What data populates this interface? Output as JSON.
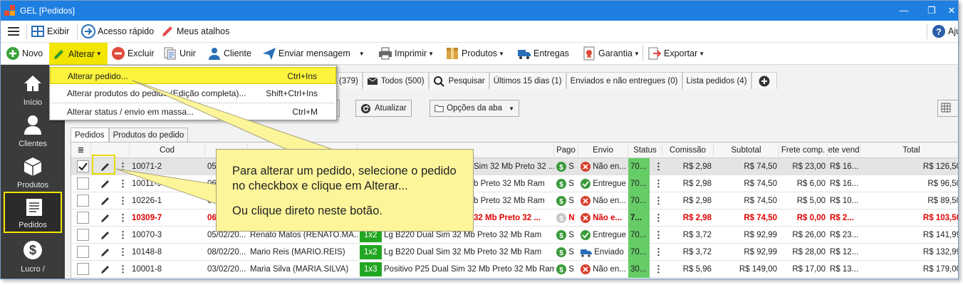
{
  "window": {
    "title": "GEL [Pedidos]",
    "colors": {
      "titlebar": "#1f7fe0",
      "sidebar": "#3b3b3b",
      "highlight": "#f2e600",
      "callout": "#fdf59a"
    }
  },
  "toolbar1": {
    "exibir": "Exibir",
    "acesso_rapido": "Acesso rápido",
    "meus_atalhos": "Meus atalhos",
    "ajuda": "Aju"
  },
  "toolbar2": {
    "novo": "Novo",
    "alterar": "Alterar",
    "excluir": "Excluir",
    "unir": "Unir",
    "cliente": "Cliente",
    "enviar_mensagem": "Enviar mensagem",
    "imprimir": "Imprimir",
    "produtos": "Produtos",
    "entregas": "Entregas",
    "garantia": "Garantia",
    "exportar": "Exportar"
  },
  "sidebar": {
    "items": [
      {
        "label": "Início"
      },
      {
        "label": "Clientes"
      },
      {
        "label": "Produtos"
      },
      {
        "label": "Pedidos"
      },
      {
        "label": "Lucro /"
      }
    ]
  },
  "menu": {
    "items": [
      {
        "label": "Alterar pedido...",
        "shortcut": "Ctrl+Ins"
      },
      {
        "label": "Alterar produtos do pedido (Edição completa)...",
        "shortcut": "Shift+Ctrl+Ins"
      },
      {
        "label": "Alterar status / envio em massa...",
        "shortcut": "Ctrl+M"
      }
    ]
  },
  "filter_tabs": {
    "count_379": "(379)",
    "todos": "Todos (500)",
    "pesquisar": "Pesquisar",
    "ultimos": "Últimos 15 dias (1)",
    "enviados": "Enviados e não entregues (0)",
    "lista": "Lista pedidos (4)",
    "add": "+"
  },
  "actions": {
    "atualizar": "Atualizar",
    "opcoes": "Opções da aba"
  },
  "inner_tabs": {
    "pedidos": "Pedidos",
    "produtos_pedido": "Produtos do pedido"
  },
  "columns": {
    "cod": "Cod",
    "pago": "Pago",
    "envio": "Envio",
    "status": "Status",
    "comissao": "Comissão",
    "subtotal": "Subtotal",
    "frete_comp": "Frete comp.",
    "frete_vend": "ete vend",
    "total": "Total"
  },
  "rows": [
    {
      "cod": "10071-2",
      "data": "05/",
      "pago_letter": "S",
      "envio": "Não en...",
      "status": "70...",
      "comissao": "R$ 2,98",
      "subtotal": "R$ 74,50",
      "frete_comp": "R$ 23,00",
      "frete_vend": "R$ 16...",
      "total": "R$ 126,50",
      "produto_tail": "Sim 32 Mb Preto 32 ..."
    },
    {
      "cod": "10011-9",
      "data": "06/",
      "pago_letter": "S",
      "envio": "Entregue",
      "status": "70...",
      "comissao": "R$ 2,98",
      "subtotal": "R$ 74,50",
      "frete_comp": "R$ 6,00",
      "frete_vend": "R$ 16...",
      "total": "R$ 96,50",
      "produto_tail": "b Preto 32 Mb Ram"
    },
    {
      "cod": "10226-1",
      "data": "06/",
      "pago_letter": "S",
      "envio": "Não en...",
      "status": "70...",
      "comissao": "R$ 2,98",
      "subtotal": "R$ 74,50",
      "frete_comp": "R$ 5,00",
      "frete_vend": "R$ 10...",
      "total": "R$ 89,50",
      "produto_tail": "b Preto 32 Mb Ram"
    },
    {
      "cod": "10309-7",
      "data": "06",
      "pago_letter": "N",
      "envio": "Não e...",
      "status": "7...",
      "comissao": "R$ 2,98",
      "subtotal": "R$ 74,50",
      "frete_comp": "R$ 0,00",
      "frete_vend": "R$ 2...",
      "total": "R$ 103,50",
      "produto_tail": "32 Mb Preto 32 ..."
    },
    {
      "cod": "10070-3",
      "data": "05/02/20...",
      "cliente": "Renato Matos (RENATO.MA...",
      "qty": "1x2",
      "produto": "Lg B220 Dual Sim 32 Mb Preto 32 Mb Ram",
      "pago_letter": "S",
      "envio": "Entregue",
      "status": "70...",
      "comissao": "R$ 3,72",
      "subtotal": "R$ 92,99",
      "frete_comp": "R$ 26,00",
      "frete_vend": "R$ 23...",
      "total": "R$ 141,99"
    },
    {
      "cod": "10148-8",
      "data": "08/02/20...",
      "cliente": "Mario Reis (MARIO.REIS)",
      "qty": "1x2",
      "produto": "Lg B220 Dual Sim 32 Mb Preto 32 Mb Ram",
      "pago_letter": "S",
      "envio": "Enviado",
      "status": "70...",
      "comissao": "R$ 3,72",
      "subtotal": "R$ 92,99",
      "frete_comp": "R$ 28,00",
      "frete_vend": "R$ 12...",
      "total": "R$ 132,99"
    },
    {
      "cod": "10001-8",
      "data": "03/02/20...",
      "cliente": "Maria Silva (MARIA.SILVA)",
      "qty": "1x3",
      "produto": "Positivo P25 Dual Sim 32 Mb Preto 32 Mb Ram",
      "pago_letter": "S",
      "envio": "Não en...",
      "status": "30...",
      "comissao": "R$ 5,96",
      "subtotal": "R$ 149,00",
      "frete_comp": "R$ 17,00",
      "frete_vend": "R$ 13...",
      "total": "R$ 179,00"
    }
  ],
  "callout": {
    "line1": "Para alterar um pedido, selecione o pedido no checkbox e clique em Alterar...",
    "line2": "Ou clique direto neste botão."
  }
}
